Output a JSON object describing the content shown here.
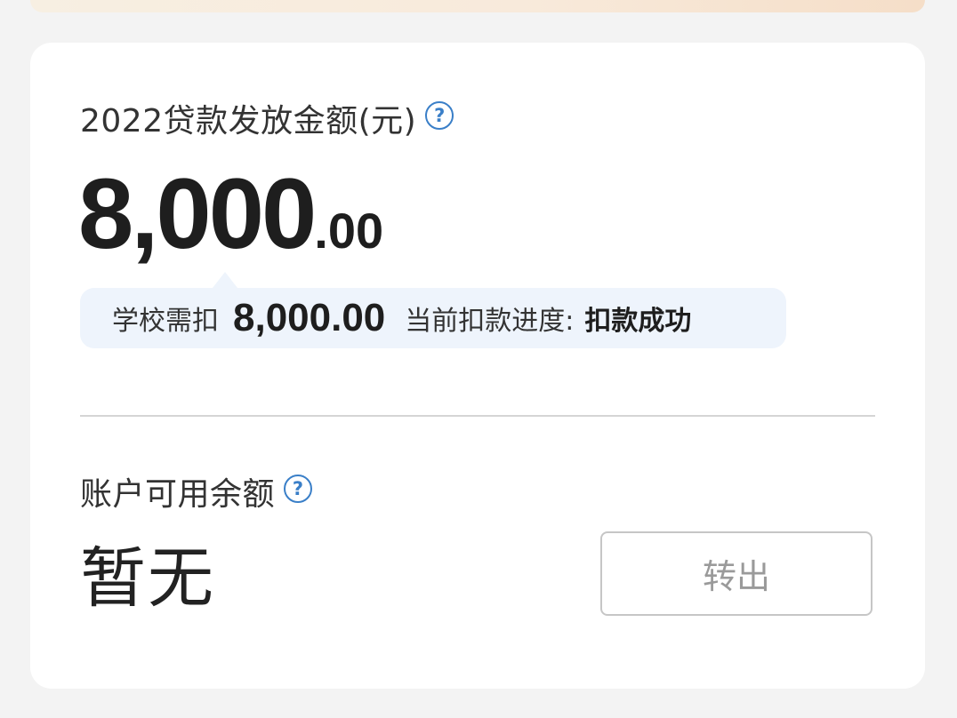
{
  "loan": {
    "label": "2022贷款发放金额(元)",
    "amount_integer": "8,000",
    "amount_decimal": ".00",
    "help_icon": "question-circle-icon"
  },
  "deduction": {
    "label": "学校需扣",
    "amount": "8,000.00",
    "progress_label": "当前扣款进度:",
    "progress_status": "扣款成功"
  },
  "balance": {
    "label": "账户可用余额",
    "value": "暂无",
    "help_icon": "question-circle-icon"
  },
  "actions": {
    "transfer_label": "转出"
  },
  "colors": {
    "accent": "#3a7fc8",
    "bubble_bg": "#eef4fc",
    "button_text_disabled": "#9a9a9a"
  }
}
